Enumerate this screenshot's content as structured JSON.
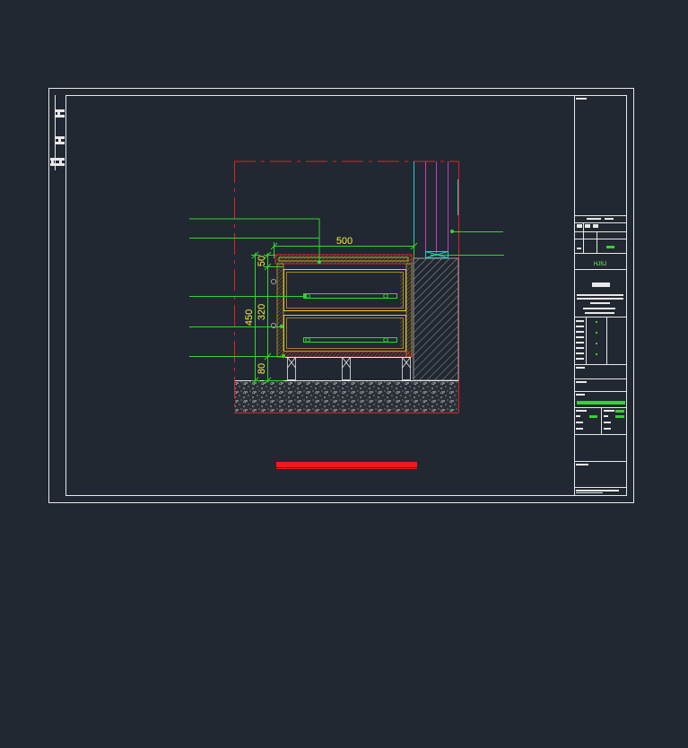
{
  "drawing": {
    "dimensions": {
      "width": "500",
      "top": "50",
      "total": "450",
      "middle": "320",
      "bottom": "80"
    },
    "title_block": {
      "logo_text": "HJSJ"
    },
    "colors": {
      "background": "#222831",
      "frame": "#e8e8e8",
      "section_outline": "#e0202a",
      "dimension": "#f2f23a",
      "leader": "#33d433",
      "cabinet": "#f2c21a",
      "hatch": "#8a8a8a",
      "teal": "#1fd0c8",
      "magenta": "#c83cc8",
      "title_bar": "#ee1a1a"
    },
    "icons": [
      "crosshatch-symbol",
      "leader-dot-marker",
      "break-line-symbol"
    ]
  }
}
